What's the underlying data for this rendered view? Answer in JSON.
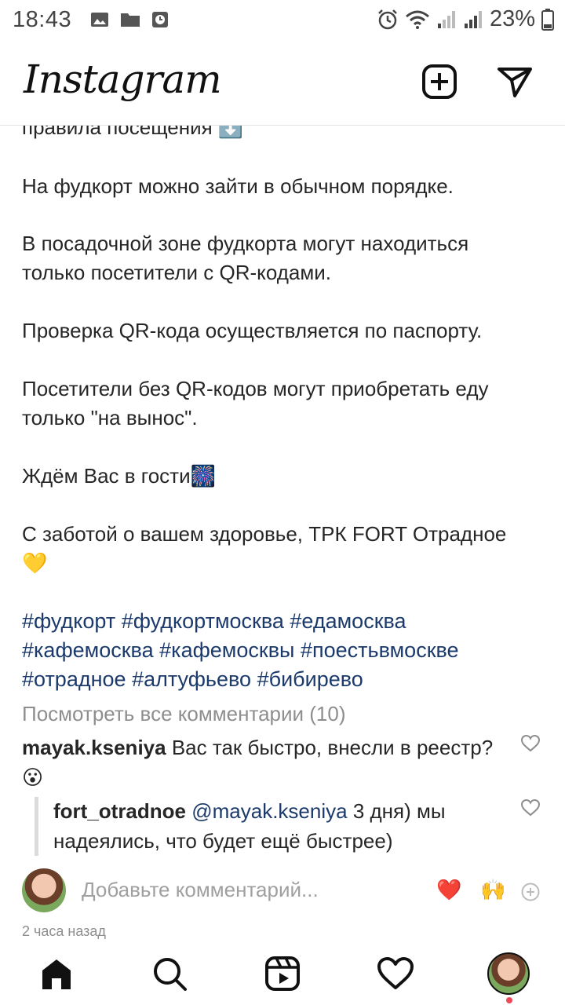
{
  "status_bar": {
    "time": "18:43",
    "battery": "23%",
    "icons_left": [
      "image-icon",
      "folder-icon",
      "clock-app-icon"
    ],
    "icons_right": [
      "alarm-icon",
      "wifi-icon",
      "signal-icon",
      "signal-icon",
      "battery-icon"
    ]
  },
  "header": {
    "logo": "Instagram",
    "new_post_icon": "plus-square-icon",
    "direct_icon": "paper-plane-icon"
  },
  "caption": {
    "lines": [
      "правила посещения ⬇️",
      "На фудкорт можно зайти в обычном порядке.",
      "В посадочной зоне фудкорта могут находиться",
      "только посетители с QR-кодами.",
      "Проверка QR-кода осуществляется по паспорту.",
      "Посетители без QR-кодов могут приобретать еду",
      "только \"на вынос\".",
      "Ждём Вас в гости🎆",
      "С заботой о вашем здоровье, ТРК FORT Отрадное",
      "💛"
    ],
    "hashtags": [
      "#фудкорт",
      "#фудкортмосква",
      "#едамосква",
      "#кафемосква",
      "#кафемосквы",
      "#поестьвмоскве",
      "#отрадное",
      "#алтуфьево",
      "#бибирево"
    ]
  },
  "comments": {
    "view_all": "Посмотреть все комментарии (10)",
    "items": [
      {
        "user": "mayak.kseniya",
        "text": "Вас так быстро, внесли в реестр?😮"
      }
    ],
    "reply": {
      "user": "fort_otradnoe",
      "mention": "@mayak.kseniya",
      "text": "3 дня) мы надеялись, что будет ещё быстрее)"
    }
  },
  "add_comment": {
    "placeholder": "Добавьте комментарий...",
    "quick_emojis": [
      "❤️",
      "🙌"
    ]
  },
  "time_ago": "2 часа назад",
  "nav": {
    "items": [
      "home-icon",
      "search-icon",
      "reels-icon",
      "heart-icon",
      "profile-avatar"
    ]
  },
  "colors": {
    "hashtag": "#1b3a6b",
    "muted": "#8e8e8e",
    "text": "#262626",
    "notification_dot": "#ed4956"
  }
}
